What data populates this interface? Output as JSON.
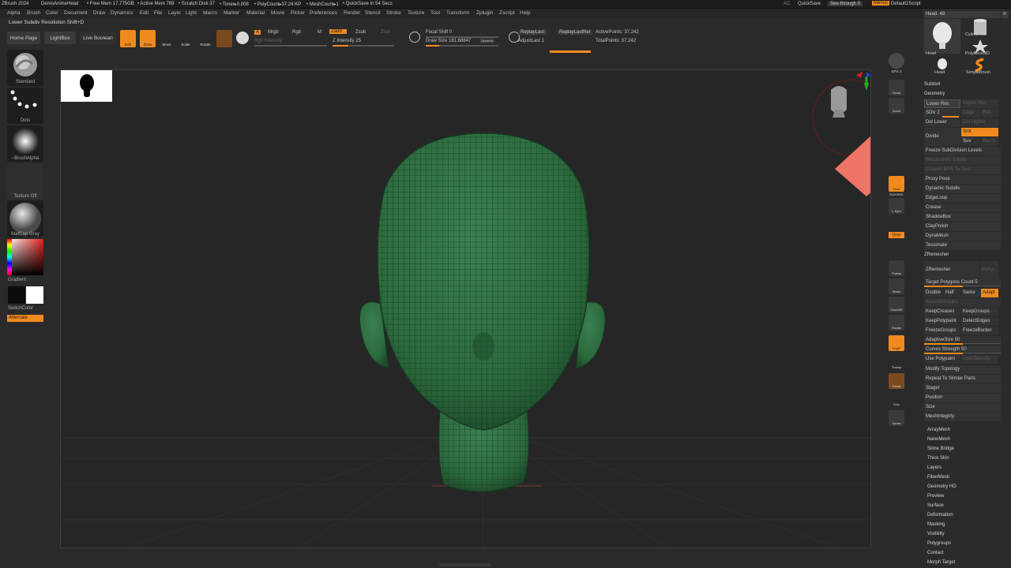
{
  "app_bar": {
    "app": "ZBrush 2024",
    "doc": "DemoAnimeHead",
    "free_mem": "• Free Mem 17.775GB",
    "active_mem": "• Active Mem 789",
    "scratch": "• Scratch Disk 37",
    "timer": "• Timer▸0.008",
    "polycount": "• PolyCount▸37.24 KP",
    "meshcount": "• MeshCount▸1",
    "quicksave_in": "• QuickSave In 54 Secs",
    "ac": "AC",
    "quicksave": "QuickSave",
    "see_through": "See-through  0",
    "menus": "Menus",
    "default_script": "Default2Script"
  },
  "menu_items": [
    "Alpha",
    "Brush",
    "Color",
    "Document",
    "Draw",
    "Dynamics",
    "Edit",
    "File",
    "Layer",
    "Light",
    "Macro",
    "Marker",
    "Material",
    "Movie",
    "Picker",
    "Preferences",
    "Render",
    "Stencil",
    "Stroke",
    "Texture",
    "Tool",
    "Transform",
    "Zplugin",
    "Zscript",
    "Help"
  ],
  "tip_line": "Lower Subdiv Resolution Shift+D",
  "toolbar": {
    "home_page": "Home Page",
    "lightbox": "LightBox",
    "live_boolean": "Live Boolean",
    "edit": "Edit",
    "draw": "Draw",
    "move": "Move",
    "scale": "Scale",
    "rotate": "Rotate",
    "a": "A",
    "mrgb": "Mrgb",
    "rgb": "Rgb",
    "m": "M",
    "zadd": "Zadd",
    "zsub": "Zsub",
    "zcut": "Zcut",
    "rgb_intensity": "Rgb Intensity",
    "z_intensity": "Z Intensity 25",
    "focal_shift": "Focal Shift 0",
    "draw_size": "Draw Size  181.68847",
    "dynamic": "Dynamic",
    "replay_last": "ReplayLast",
    "replay_last_rel": "ReplayLastRel",
    "adjust_last": "AdjustLast  1",
    "active_points": "ActivePoints: 37,242",
    "total_points": "TotalPoints: 37,242"
  },
  "left_shelf": {
    "brush": "Standard",
    "stroke": "Dots",
    "alpha": "~BrushAlpha",
    "texture": "Texture Off",
    "material": "MatCap Gray",
    "gradient": "Gradient",
    "switch_color": "SwitchColor",
    "alternate": "Alternate"
  },
  "right_shelf": {
    "spix": "SPix 3",
    "scroll": "Scroll",
    "zoom": "Zoom",
    "floor": "Floor",
    "dynamic": "Dynamic",
    "lsym": "L.Sym",
    "xyz": "Qxyz",
    "frame": "Frame",
    "move": "Move",
    "zoom3d": "Zoom3D",
    "rotate": "Rotate",
    "polyf": "PolyF",
    "transp": "Transp",
    "ghost": "Ghost",
    "solo": "Solo",
    "xpose": "Xpose"
  },
  "tool_tray": {
    "tool_name": "Head. 48",
    "r": "R",
    "thumbs": [
      "Head",
      "Cylinder3D",
      "PolyMesh3D",
      "Head",
      "SimpleBrush"
    ],
    "subtool": "Subtool",
    "geometry": "Geometry",
    "lower_res": "Lower Res",
    "higher_res": "Higher Res",
    "sdiv": "SDiv 2",
    "cage": "Cage",
    "rstr": "Rstr",
    "del_lower": "Del Lower",
    "del_higher": "Del Higher",
    "divide": "Divide",
    "smt": "Smt",
    "suv": "Suv",
    "reuv": "ReUV",
    "freeze_subdiv": "Freeze SubDivision Levels",
    "reconstruct": "Reconstruct Subdiv",
    "convert_bpr": "Convert BPR To Geo",
    "proxy_pose": "Proxy Pose",
    "dynamic_subdiv": "Dynamic Subdiv",
    "edgeloop": "EdgeLoop",
    "crease": "Crease",
    "shadowbox": "ShadowBox",
    "claypolish": "ClayPolish",
    "dynamesh": "DynaMesh",
    "tessimate": "Tessimate",
    "zremesher_hdr": "ZRemesher",
    "zremesher_btn": "ZRemesher",
    "retry": "Retry",
    "target_polys": "Target Polygons Count 5",
    "double": "Double",
    "half": "Half",
    "same": "Same",
    "adapt": "Adapt",
    "smoothgroups": "SmoothGroups",
    "keepcreases": "KeepCreases",
    "keepgroups": "KeepGroups",
    "keeppolypaint": "KeepPolypaint",
    "detectedges": "DetectEdges",
    "freezegroups": "FreezeGroups",
    "freezeborder": "FreezeBorder",
    "adaptivesize": "AdaptiveSize 50",
    "curves_strength": "Curves Strength 50",
    "use_polypaint": "Use Polypaint",
    "color_density": "ColorDensity",
    "modify_topology": "Modify Topology",
    "repeat_similar": "Repeat To Similar Parts",
    "stager": "Stager",
    "position": "Position",
    "size": "Size",
    "meshintegrity": "MeshIntegrity",
    "sections": [
      "ArrayMesh",
      "NanoMesh",
      "Slime Bridge",
      "Thick Skin",
      "Layers",
      "FiberMesh",
      "Geometry HD",
      "Preview",
      "Surface",
      "Deformation",
      "Masking",
      "Visibility",
      "Polygroups",
      "Contact",
      "Morph Target"
    ]
  },
  "progress": {
    "z_intensity": 0.25,
    "draw_size_fraction": 0.18,
    "adjust_last": 1.0,
    "target_polygons": 0.5,
    "adaptive_size": 0.5,
    "curves_strength": 0.5
  },
  "colors": {
    "accent": "#f08a1e",
    "mesh": "#2f6b3f",
    "callout_arrow": "#ee7466",
    "panel": "#2b2b2b"
  }
}
